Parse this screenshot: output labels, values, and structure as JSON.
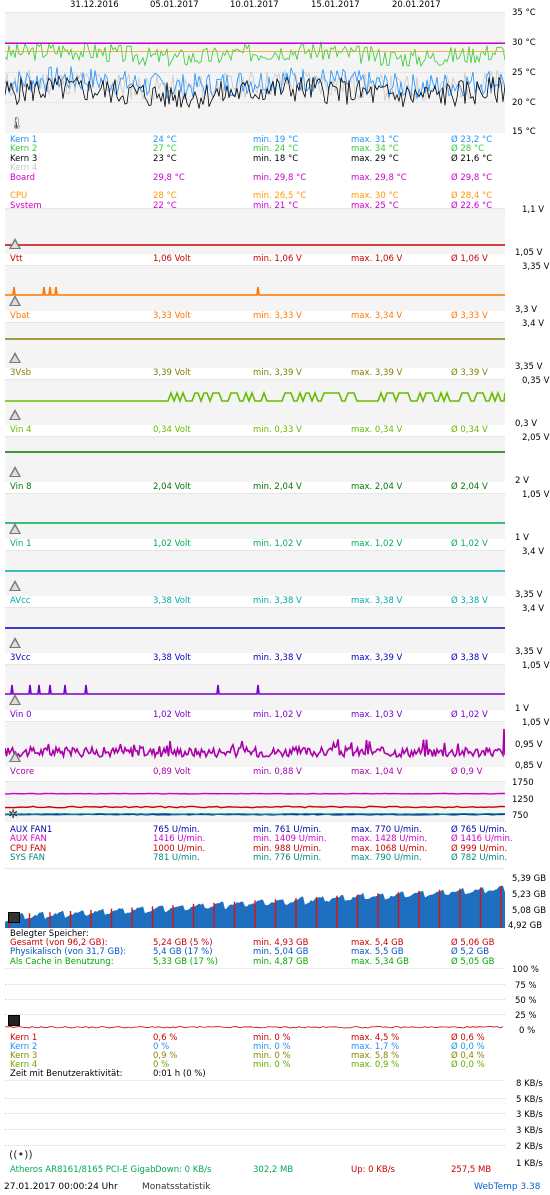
{
  "header": {
    "dates": [
      "31.12.2016",
      "05.01.2017",
      "10.01.2017",
      "15.01.2017",
      "20.01.2017"
    ]
  },
  "temp": {
    "yticks": [
      "35 °C",
      "30 °C",
      "25 °C",
      "20 °C",
      "15 °C"
    ],
    "rows": [
      {
        "name": "Kern 1",
        "cur": "24 °C",
        "min": "min. 19 °C",
        "max": "max. 31 °C",
        "avg": "Ø 23,2 °C",
        "color": "#1e90ff"
      },
      {
        "name": "Kern 2",
        "cur": "27 °C",
        "min": "min. 24 °C",
        "max": "max. 34 °C",
        "avg": "Ø 28 °C",
        "color": "#33cc33"
      },
      {
        "name": "Kern 3",
        "cur": "23 °C",
        "min": "min. 18 °C",
        "max": "max. 29 °C",
        "avg": "Ø 21,6 °C",
        "color": "#000000"
      },
      {
        "name": "Kern 4",
        "cur": "",
        "min": "",
        "max": "",
        "avg": "",
        "color": "#c8c8c8"
      },
      {
        "name": "Board",
        "cur": "29,8 °C",
        "min": "min. 29,8 °C",
        "max": "max. 29,8 °C",
        "avg": "Ø 29,8 °C",
        "color": "#cc00cc"
      },
      {
        "name": "",
        "cur": "",
        "min": "",
        "max": "",
        "avg": "",
        "color": "#000000"
      },
      {
        "name": "CPU",
        "cur": "28 °C",
        "min": "min. 26,5 °C",
        "max": "max. 30 °C",
        "avg": "Ø 28,4 °C",
        "color": "#ff9900"
      },
      {
        "name": "System",
        "cur": "22 °C",
        "min": "min. 21 °C",
        "max": "max. 25 °C",
        "avg": "Ø 22,6 °C",
        "color": "#cc00cc"
      }
    ]
  },
  "voltages": [
    {
      "label": "Vtt",
      "cur": "1,06 Volt",
      "min": "min. 1,06 V",
      "max": "max. 1,06 V",
      "avg": "Ø 1,06 V",
      "color": "#cc0000",
      "ytop": "1,1 V",
      "ybot": "1,05 V"
    },
    {
      "label": "Vbat",
      "cur": "3,33 Volt",
      "min": "min. 3,33 V",
      "max": "max. 3,34 V",
      "avg": "Ø 3,33 V",
      "color": "#ff7700",
      "ytop": "3,35 V",
      "ybot": "3,3 V"
    },
    {
      "label": "3Vsb",
      "cur": "3,39 Volt",
      "min": "min. 3,39 V",
      "max": "max. 3,39 V",
      "avg": "Ø 3,39 V",
      "color": "#808000",
      "ytop": "3,4 V",
      "ybot": "3,35 V"
    },
    {
      "label": "Vin 4",
      "cur": "0,34 Volt",
      "min": "min. 0,33 V",
      "max": "max. 0,34 V",
      "avg": "Ø 0,34 V",
      "color": "#66bb00",
      "ytop": "0,35 V",
      "ybot": "0,3 V"
    },
    {
      "label": "Vin 8",
      "cur": "2,04 Volt",
      "min": "min. 2,04 V",
      "max": "max. 2,04 V",
      "avg": "Ø 2,04 V",
      "color": "#007700",
      "ytop": "2,05 V",
      "ybot": "2 V"
    },
    {
      "label": "Vin 1",
      "cur": "1,02 Volt",
      "min": "min. 1,02 V",
      "max": "max. 1,02 V",
      "avg": "Ø 1,02 V",
      "color": "#00aa55",
      "ytop": "1,05 V",
      "ybot": "1 V"
    },
    {
      "label": "AVcc",
      "cur": "3,38 Volt",
      "min": "min. 3,38 V",
      "max": "max. 3,38 V",
      "avg": "Ø 3,38 V",
      "color": "#00aaaa",
      "ytop": "3,4 V",
      "ybot": "3,35 V"
    },
    {
      "label": "3Vcc",
      "cur": "3,38 Volt",
      "min": "min. 3,38 V",
      "max": "max. 3,39 V",
      "avg": "Ø 3,38 V",
      "color": "#0000bb",
      "ytop": "3,4 V",
      "ybot": "3,35 V"
    },
    {
      "label": "Vin 0",
      "cur": "1,02 Volt",
      "min": "min. 1,02 V",
      "max": "max. 1,03 V",
      "avg": "Ø 1,02 V",
      "color": "#7700cc",
      "ytop": "1,05 V",
      "ybot": "1 V"
    },
    {
      "label": "Vcore",
      "cur": "0,89 Volt",
      "min": "min. 0,88 V",
      "max": "max. 1,04 V",
      "avg": "Ø 0,9 V",
      "color": "#aa00aa",
      "ytop": "1,05 V",
      "ymid": "0,95 V",
      "ybot": "0,85 V"
    }
  ],
  "fans": {
    "yticks": [
      "1750",
      "1250",
      "750"
    ],
    "rows": [
      {
        "name": "AUX FAN1",
        "cur": "765 U/min.",
        "min": "min. 761 U/min.",
        "max": "max. 770 U/min.",
        "avg": "Ø 765 U/min.",
        "color": "#0000aa"
      },
      {
        "name": "AUX FAN",
        "cur": "1416 U/min.",
        "min": "min. 1409 U/min.",
        "max": "max. 1428 U/min.",
        "avg": "Ø 1416 U/min.",
        "color": "#cc00cc"
      },
      {
        "name": "CPU FAN",
        "cur": "1000 U/min.",
        "min": "min. 988 U/min.",
        "max": "max. 1068 U/min.",
        "avg": "Ø 999 U/min.",
        "color": "#cc0000"
      },
      {
        "name": "SYS FAN",
        "cur": "781 U/min.",
        "min": "min. 776 U/min.",
        "max": "max. 790 U/min.",
        "avg": "Ø 782 U/min.",
        "color": "#008888"
      }
    ]
  },
  "memory": {
    "yticks": [
      "5,39 GB",
      "5,23 GB",
      "5,08 GB",
      "4,92 GB"
    ],
    "heading": "Belegter Speicher:",
    "rows": [
      {
        "name": "Gesamt (von 96,2 GB):",
        "cur": "5,24 GB (5 %)",
        "min": "min. 4,93 GB",
        "max": "max. 5,4 GB",
        "avg": "Ø 5,06 GB",
        "color": "#cc0000"
      },
      {
        "name": "Physikalisch (von 31,7 GB):",
        "cur": "5,4 GB (17 %)",
        "min": "min. 5,04 GB",
        "max": "max. 5,5 GB",
        "avg": "Ø 5,2 GB",
        "color": "#0055cc"
      },
      {
        "name": "Als Cache in Benutzung:",
        "cur": "5,33 GB (17 %)",
        "min": "min. 4,87 GB",
        "max": "max. 5,34 GB",
        "avg": "Ø 5,05 GB",
        "color": "#00aa00"
      }
    ]
  },
  "cpu": {
    "yticks": [
      "100 %",
      "75 %",
      "50 %",
      "25 %",
      "0 %"
    ],
    "rows": [
      {
        "name": "Kern 1",
        "cur": "0,6 %",
        "min": "min. 0 %",
        "max": "max. 4,5 %",
        "avg": "Ø 0,6 %",
        "color": "#cc0000"
      },
      {
        "name": "Kern 2",
        "cur": "0 %",
        "min": "min. 0 %",
        "max": "max. 1,7 %",
        "avg": "Ø 0,0 %",
        "color": "#1e90ff"
      },
      {
        "name": "Kern 3",
        "cur": "0,9 %",
        "min": "min. 0 %",
        "max": "max. 5,8 %",
        "avg": "Ø 0,4 %",
        "color": "#888800"
      },
      {
        "name": "Kern 4",
        "cur": "0 %",
        "min": "min. 0 %",
        "max": "max. 0,9 %",
        "avg": "Ø 0,0 %",
        "color": "#66aa00"
      }
    ],
    "activity_label": "Zeit mit Benutzeraktivität:",
    "activity_value": "0:01 h (0 %)"
  },
  "network": {
    "yticks": [
      "8 KB/s",
      "5 KB/s",
      "3 KB/s",
      "3 KB/s",
      "2 KB/s",
      "1 KB/s"
    ],
    "adapter": "Atheros AR8161/8165 PCI-E Gigab",
    "down": "Down: 0 KB/s",
    "down_total": "302,2 MB",
    "up": "Up: 0 KB/s",
    "up_total": "257,5 MB"
  },
  "footer": {
    "timestamp": "27.01.2017 00:00:24 Uhr",
    "mode": "Monatsstatistik",
    "brand": "WebTemp 3.38"
  }
}
